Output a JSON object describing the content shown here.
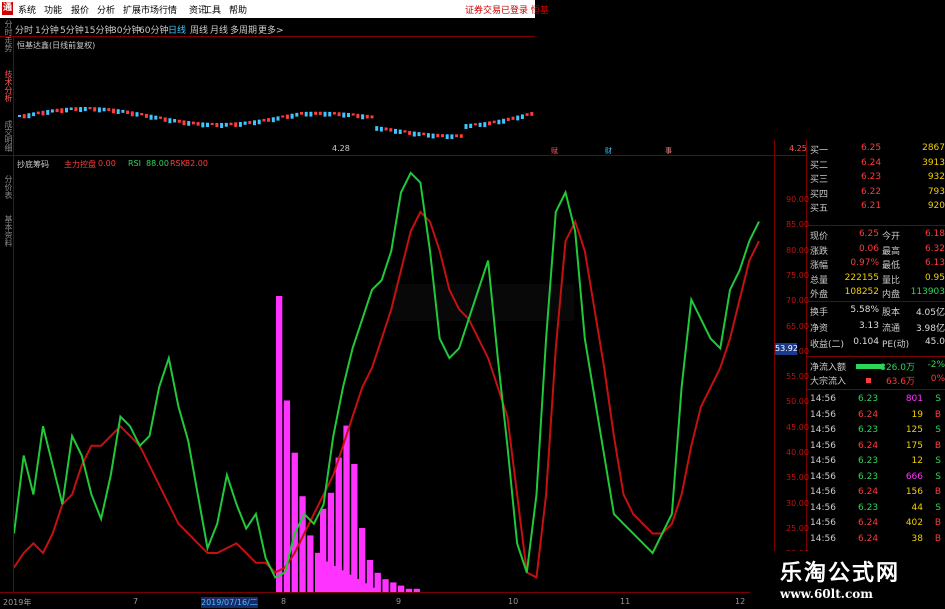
{
  "colors": {
    "up": "#ff3b3b",
    "down": "#2bd75a",
    "cyan": "#3ec6ff",
    "magenta": "#ff33ff",
    "yellow": "#f0d000",
    "green_line": "#20c83a",
    "red_line": "#c41010"
  },
  "menubar": {
    "logo": "通",
    "items": [
      "系统",
      "功能",
      "报价",
      "分析",
      "扩展市场行情",
      "资讯",
      "工具",
      "帮助"
    ],
    "login_text": "证券交易已登录 恒基"
  },
  "periods": {
    "items": [
      "分时",
      "1分钟",
      "5分钟",
      "15分钟",
      "30分钟",
      "60分钟",
      "日线",
      "周线",
      "月线",
      "多周期",
      "更多>"
    ],
    "active_index": 6
  },
  "side_tabs": {
    "top": [
      "分时走势",
      "技术分析",
      "成交明细"
    ],
    "bottom": [
      "分价表",
      "基本资料"
    ]
  },
  "main_chart_title": "恒基达鑫(日线前复权)",
  "price_label_low": "4.28",
  "price_label_right": "4.25",
  "event_markers": [
    "赋",
    "财",
    "事"
  ],
  "indicator": {
    "name": "抄底筹码",
    "param1_label": "主力控盘",
    "param1_value": "0.00",
    "param2_label": "RSI",
    "param2_value": "88.00",
    "param3_label": "RSK",
    "param3_value": "82.00",
    "y_ticks": [
      "90.00",
      "85.00",
      "80.00",
      "75.00",
      "70.00",
      "65.00",
      "60.00",
      "55.00",
      "50.00",
      "45.00",
      "40.00",
      "35.00",
      "30.00",
      "25.00",
      "20.00",
      "15.00"
    ],
    "current_value": "53.92"
  },
  "x_axis": [
    "2019年",
    "7",
    "2019/07/16/二",
    "8",
    "9",
    "10",
    "11",
    "12"
  ],
  "quote": {
    "bids": [
      {
        "label": "买一",
        "price": "6.25",
        "vol": "2867"
      },
      {
        "label": "买二",
        "price": "6.24",
        "vol": "3913"
      },
      {
        "label": "买三",
        "price": "6.23",
        "vol": "932"
      },
      {
        "label": "买四",
        "price": "6.22",
        "vol": "793"
      },
      {
        "label": "买五",
        "price": "6.21",
        "vol": "920"
      }
    ],
    "stats": [
      {
        "l1": "现价",
        "v1": "6.25",
        "l2": "今开",
        "v2": "6.18"
      },
      {
        "l1": "涨跌",
        "v1": "0.06",
        "l2": "最高",
        "v2": "6.32"
      },
      {
        "l1": "涨幅",
        "v1": "0.97%",
        "l2": "最低",
        "v2": "6.13"
      },
      {
        "l1": "总量",
        "v1": "222155",
        "l2": "量比",
        "v2": "0.95"
      },
      {
        "l1": "外盘",
        "v1": "108252",
        "l2": "内盘",
        "v2": "113903"
      }
    ],
    "stats2": [
      {
        "l1": "换手",
        "v1": "5.58%",
        "l2": "股本",
        "v2": "4.05亿"
      },
      {
        "l1": "净资",
        "v1": "3.13",
        "l2": "流通",
        "v2": "3.98亿"
      },
      {
        "l1": "收益(二)",
        "v1": "0.104",
        "l2": "PE(动)",
        "v2": "45.0"
      }
    ],
    "flow": [
      {
        "label": "净流入额",
        "value": "-326.0万",
        "pct": "-2%"
      },
      {
        "label": "大宗流入",
        "value": "63.6万",
        "pct": "0%"
      }
    ],
    "ticks": [
      {
        "time": "14:56",
        "price": "6.23",
        "vol": "801",
        "side": "S"
      },
      {
        "time": "14:56",
        "price": "6.24",
        "vol": "19",
        "side": "B"
      },
      {
        "time": "14:56",
        "price": "6.23",
        "vol": "125",
        "side": "S"
      },
      {
        "time": "14:56",
        "price": "6.24",
        "vol": "175",
        "side": "B"
      },
      {
        "time": "14:56",
        "price": "6.23",
        "vol": "12",
        "side": "S"
      },
      {
        "time": "14:56",
        "price": "6.23",
        "vol": "666",
        "side": "S"
      },
      {
        "time": "14:56",
        "price": "6.24",
        "vol": "156",
        "side": "B"
      },
      {
        "time": "14:56",
        "price": "6.23",
        "vol": "44",
        "side": "S"
      },
      {
        "time": "14:56",
        "price": "6.24",
        "vol": "402",
        "side": "B"
      },
      {
        "time": "14:56",
        "price": "6.24",
        "vol": "38",
        "side": "B"
      }
    ]
  },
  "watermark": {
    "title": "乐淘公式网",
    "url": "www.60lt.com"
  },
  "chart_data": {
    "type": "line",
    "y_range": [
      10,
      97
    ],
    "series": [
      {
        "name": "RSI",
        "color": "#20c83a",
        "values": [
          22,
          38,
          30,
          44,
          36,
          28,
          42,
          38,
          30,
          25,
          34,
          46,
          44,
          40,
          42,
          52,
          58,
          48,
          41,
          30,
          19,
          24,
          34,
          28,
          23,
          26,
          17,
          13,
          14,
          22,
          26,
          24,
          28,
          42,
          52,
          60,
          66,
          72,
          74,
          80,
          92,
          96,
          94,
          80,
          62,
          58,
          60,
          66,
          72,
          78,
          58,
          40,
          20,
          14,
          30,
          62,
          88,
          92,
          84,
          62,
          50,
          38,
          26,
          24,
          22,
          20,
          18,
          22,
          26,
          52,
          70,
          66,
          62,
          60,
          72,
          76,
          82,
          86
        ]
      },
      {
        "name": "RSK",
        "color": "#c41010",
        "values": [
          15,
          18,
          20,
          18,
          22,
          28,
          30,
          36,
          40,
          40,
          42,
          44,
          42,
          40,
          36,
          32,
          28,
          24,
          22,
          20,
          18,
          18,
          19,
          20,
          18,
          16,
          16,
          14,
          15,
          18,
          22,
          26,
          30,
          34,
          40,
          46,
          52,
          56,
          62,
          68,
          76,
          84,
          88,
          86,
          80,
          72,
          68,
          66,
          62,
          58,
          52,
          46,
          30,
          14,
          13,
          30,
          60,
          82,
          86,
          80,
          68,
          56,
          42,
          30,
          26,
          24,
          22,
          22,
          24,
          30,
          40,
          48,
          52,
          56,
          62,
          70,
          78,
          82
        ]
      },
      {
        "name": "抄底筹码",
        "color": "#ff33ff",
        "values": [
          0,
          0,
          0,
          0,
          0,
          0,
          0,
          0,
          0,
          0,
          0,
          0,
          0,
          0,
          0,
          0,
          0,
          0,
          0,
          0,
          0,
          0,
          0,
          0,
          0,
          0,
          0,
          68,
          44,
          32,
          22,
          13,
          9,
          7,
          6,
          5,
          4,
          3,
          2,
          1
        ]
      }
    ]
  }
}
